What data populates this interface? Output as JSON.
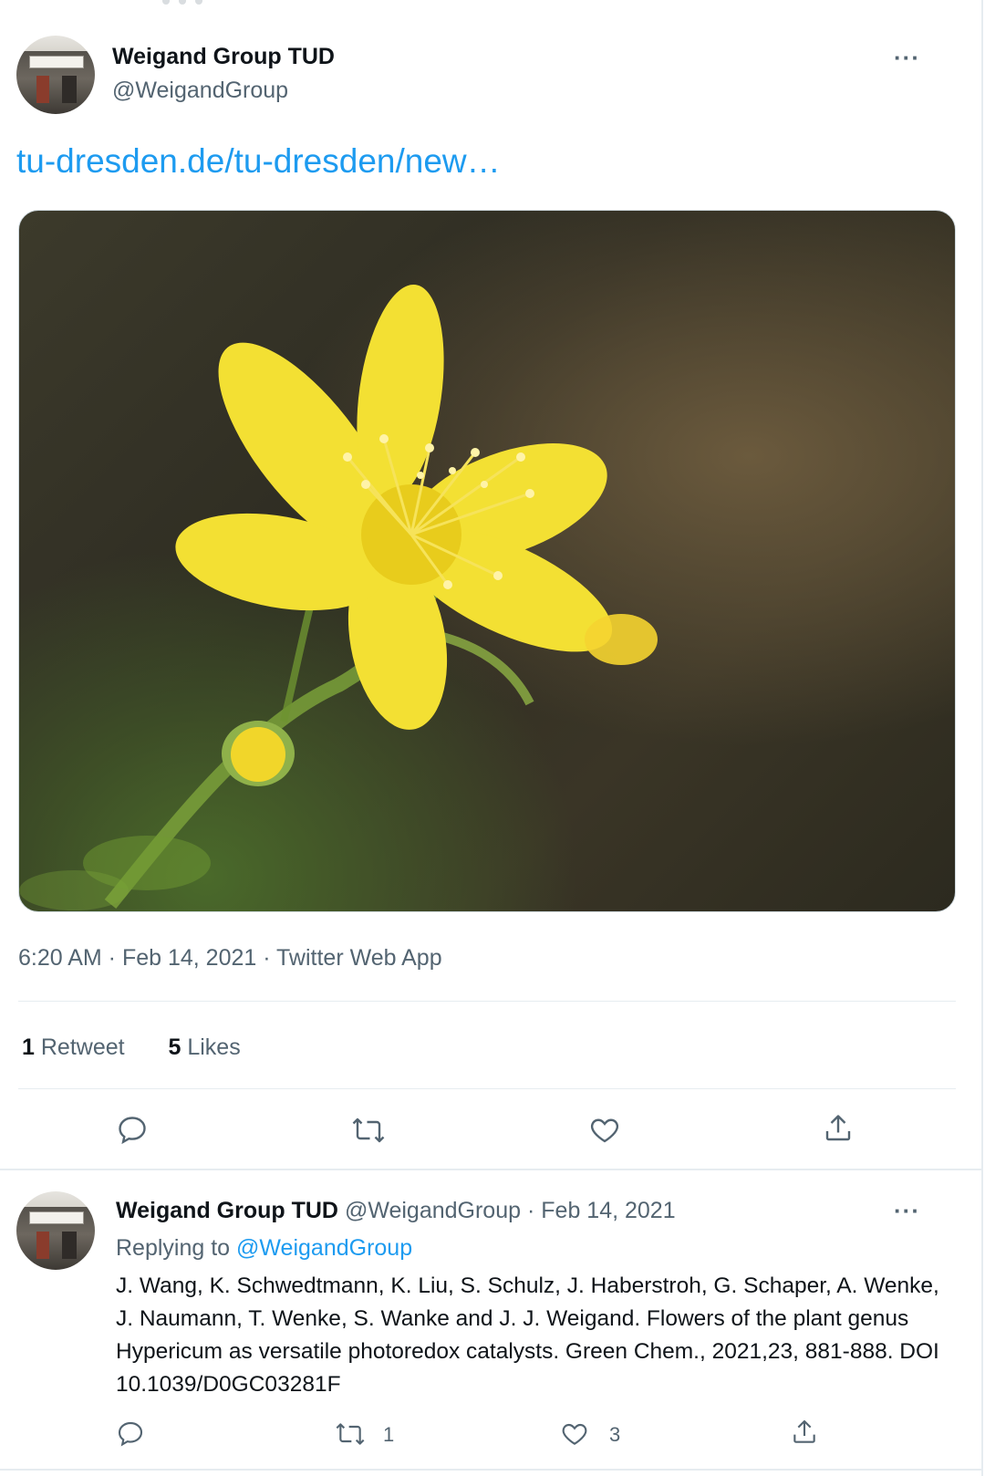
{
  "tweet": {
    "author_name": "Weigand Group TUD",
    "author_handle": "@WeigandGroup",
    "more": "···",
    "link_text": "tu-dresden.de/tu-dresden/new…",
    "timestamp": "6:20 AM · Feb 14, 2021 · Twitter Web App",
    "stats": {
      "retweets_count": "1",
      "retweets_label": "Retweet",
      "likes_count": "5",
      "likes_label": "Likes"
    },
    "actions": [
      "reply-icon",
      "retweet-icon",
      "like-icon",
      "share-icon"
    ]
  },
  "reply": {
    "author_name": "Weigand Group TUD",
    "author_handle": "@WeigandGroup",
    "date": "Feb 14, 2021",
    "replying_label": "Replying to",
    "replying_to": "@WeigandGroup",
    "text": "J. Wang, K. Schwedtmann, K. Liu, S. Schulz, J. Haberstroh, G. Schaper, A. Wenke, J. Naumann, T. Wenke, S. Wanke and J. J. Weigand. Flowers of the plant genus Hypericum as versatile photoredox catalysts. Green Chem., 2021,23, 881-888. DOI 10.1039/D0GC03281F",
    "retweet_count": "1",
    "like_count": "3"
  },
  "colors": {
    "link": "#1d9bf0",
    "secondary_text": "#536471",
    "primary_text": "#0f1419",
    "flower": "#f2dd2c"
  }
}
